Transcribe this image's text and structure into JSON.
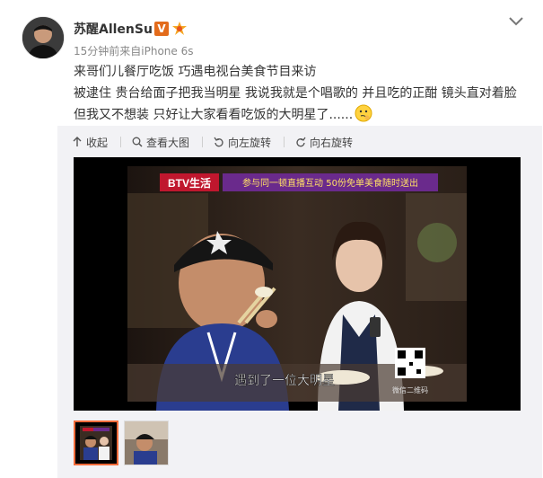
{
  "post": {
    "username": "苏醒AllenSu",
    "verified_badge": "V",
    "meta": "15分钟前来自iPhone 6s",
    "lines": [
      "来哥们儿餐厅吃饭 巧遇电视台美食节目来访",
      "被逮住 贵台给面子把我当明星 我说我就是个唱歌的 并且吃的正酣 镜头直对着脸",
      "但我又不想装 只好让大家看看吃饭的大明星了......"
    ]
  },
  "actions": [
    {
      "icon": "collapse-arrow-icon",
      "label": "收起"
    },
    {
      "icon": "zoom-icon",
      "label": "查看大图"
    },
    {
      "icon": "rotate-left-icon",
      "label": "向左旋转"
    },
    {
      "icon": "rotate-right-icon",
      "label": "向右旋转"
    }
  ],
  "video": {
    "channel_logo": "BTV生活",
    "banner": "参与同一顿直播互动 50份免单美食随时送出",
    "subtitle": "遇到了一位大明星",
    "qr_label": "微信二维码"
  },
  "colors": {
    "accent_orange": "#f26b3a",
    "panel_bg": "#f2f2f5",
    "meta_text": "#888888",
    "banner_purple": "#6a2a8c"
  }
}
